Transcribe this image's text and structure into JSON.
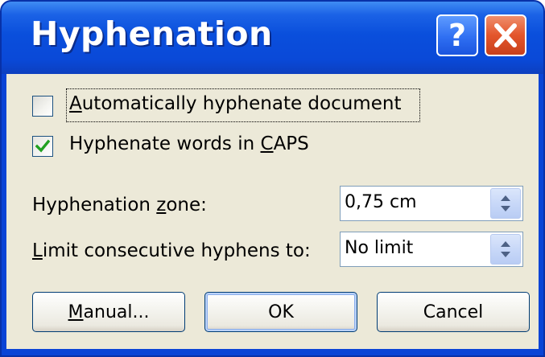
{
  "dialog": {
    "title": "Hyphenation",
    "help_label": "?"
  },
  "options": {
    "auto_hyphenate": {
      "label_prefix": "",
      "label_accel": "A",
      "label_suffix": "utomatically hyphenate document",
      "checked": false
    },
    "hyphenate_caps": {
      "label_prefix": "Hyphenate words in ",
      "label_accel": "C",
      "label_suffix": "APS",
      "checked": true
    }
  },
  "fields": {
    "zone": {
      "label_prefix": "Hyphenation ",
      "label_accel": "z",
      "label_suffix": "one:",
      "value": "0,75 cm"
    },
    "limit": {
      "label_prefix": "",
      "label_accel": "L",
      "label_suffix": "imit consecutive hyphens to:",
      "value": "No limit"
    }
  },
  "buttons": {
    "manual": {
      "accel": "M",
      "rest": "anual..."
    },
    "ok": {
      "label": "OK"
    },
    "cancel": {
      "label": "Cancel"
    }
  },
  "colors": {
    "title_bar": "#0a4fdc",
    "dialog_face": "#ece9d8",
    "close_button": "#e3552b",
    "check_mark": "#21a121"
  },
  "icons": {
    "help": "question-mark-icon",
    "close": "close-x-icon",
    "check": "check-mark-icon",
    "spinner": "spin-arrows-icon"
  }
}
